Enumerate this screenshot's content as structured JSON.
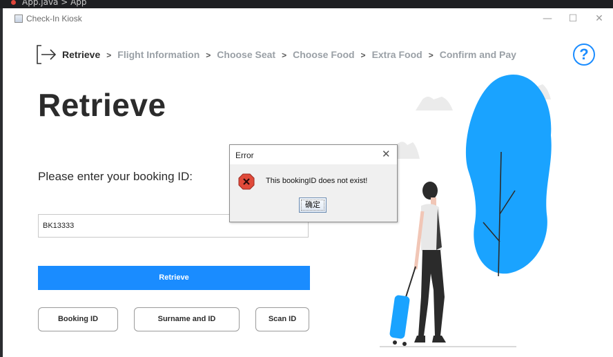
{
  "ide": {
    "breadcrumb": "App.java > App"
  },
  "window": {
    "title": "Check-In Kiosk",
    "minimize": "—",
    "maximize": "☐",
    "close": "✕"
  },
  "nav": {
    "steps": [
      {
        "label": "Retrieve",
        "active": true
      },
      {
        "label": "Flight Information",
        "active": false
      },
      {
        "label": "Choose Seat",
        "active": false
      },
      {
        "label": "Choose Food",
        "active": false
      },
      {
        "label": "Extra Food",
        "active": false
      },
      {
        "label": "Confirm and Pay",
        "active": false
      }
    ],
    "separator": ">",
    "help": "?"
  },
  "page": {
    "title": "Retrieve",
    "prompt": "Please enter your booking ID:"
  },
  "booking_input": {
    "value": "BK13333"
  },
  "buttons": {
    "retrieve": "Retrieve",
    "booking_id": "Booking ID",
    "surname_and_id": "Surname and ID",
    "scan_id": "Scan ID"
  },
  "dialog": {
    "title": "Error",
    "close": "✕",
    "message": "This bookingID does not exist!",
    "ok": "确定",
    "icon": "error-icon"
  },
  "colors": {
    "accent": "#1a8cff",
    "tree": "#1aa3ff",
    "error": "#e04a3a"
  }
}
